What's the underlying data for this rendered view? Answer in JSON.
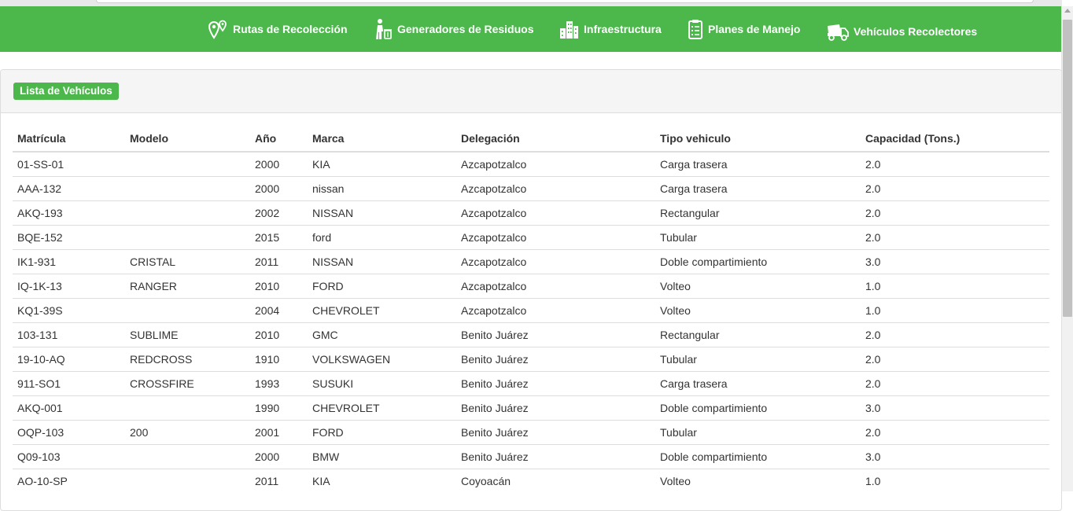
{
  "nav": {
    "items": [
      {
        "label": "Rutas de Recolección",
        "icon": "map-pin-icon"
      },
      {
        "label": "Generadores de Residuos",
        "icon": "person-trash-icon"
      },
      {
        "label": "Infraestructura",
        "icon": "buildings-icon"
      },
      {
        "label": "Planes de Manejo",
        "icon": "clipboard-icon"
      },
      {
        "label": "Vehículos Recolectores",
        "icon": "truck-icon"
      }
    ],
    "color": "#4cb84c"
  },
  "panel": {
    "title": "Lista de Vehículos"
  },
  "table": {
    "headers": [
      "Matrícula",
      "Modelo",
      "Año",
      "Marca",
      "Delegación",
      "Tipo vehiculo",
      "Capacidad (Tons.)"
    ],
    "rows": [
      [
        "01-SS-01",
        "",
        "2000",
        "KIA",
        "Azcapotzalco",
        "Carga trasera",
        "2.0"
      ],
      [
        "AAA-132",
        "",
        "2000",
        "nissan",
        "Azcapotzalco",
        "Carga trasera",
        "2.0"
      ],
      [
        "AKQ-193",
        "",
        "2002",
        "NISSAN",
        "Azcapotzalco",
        "Rectangular",
        "2.0"
      ],
      [
        "BQE-152",
        "",
        "2015",
        "ford",
        "Azcapotzalco",
        "Tubular",
        "2.0"
      ],
      [
        "IK1-931",
        "CRISTAL",
        "2011",
        "NISSAN",
        "Azcapotzalco",
        "Doble compartimiento",
        "3.0"
      ],
      [
        "IQ-1K-13",
        "RANGER",
        "2010",
        "FORD",
        "Azcapotzalco",
        "Volteo",
        "1.0"
      ],
      [
        "KQ1-39S",
        "",
        "2004",
        "CHEVROLET",
        "Azcapotzalco",
        "Volteo",
        "1.0"
      ],
      [
        "103-131",
        "SUBLIME",
        "2010",
        "GMC",
        "Benito Juárez",
        "Rectangular",
        "2.0"
      ],
      [
        "19-10-AQ",
        "REDCROSS",
        "1910",
        "VOLKSWAGEN",
        "Benito Juárez",
        "Tubular",
        "2.0"
      ],
      [
        "911-SO1",
        "CROSSFIRE",
        "1993",
        "SUSUKI",
        "Benito Juárez",
        "Carga trasera",
        "2.0"
      ],
      [
        "AKQ-001",
        "",
        "1990",
        "CHEVROLET",
        "Benito Juárez",
        "Doble compartimiento",
        "3.0"
      ],
      [
        "OQP-103",
        "200",
        "2001",
        "FORD",
        "Benito Juárez",
        "Tubular",
        "2.0"
      ],
      [
        "Q09-103",
        "",
        "2000",
        "BMW",
        "Benito Juárez",
        "Doble compartimiento",
        "3.0"
      ],
      [
        "AO-10-SP",
        "",
        "2011",
        "KIA",
        "Coyoacán",
        "Volteo",
        "1.0"
      ]
    ]
  }
}
